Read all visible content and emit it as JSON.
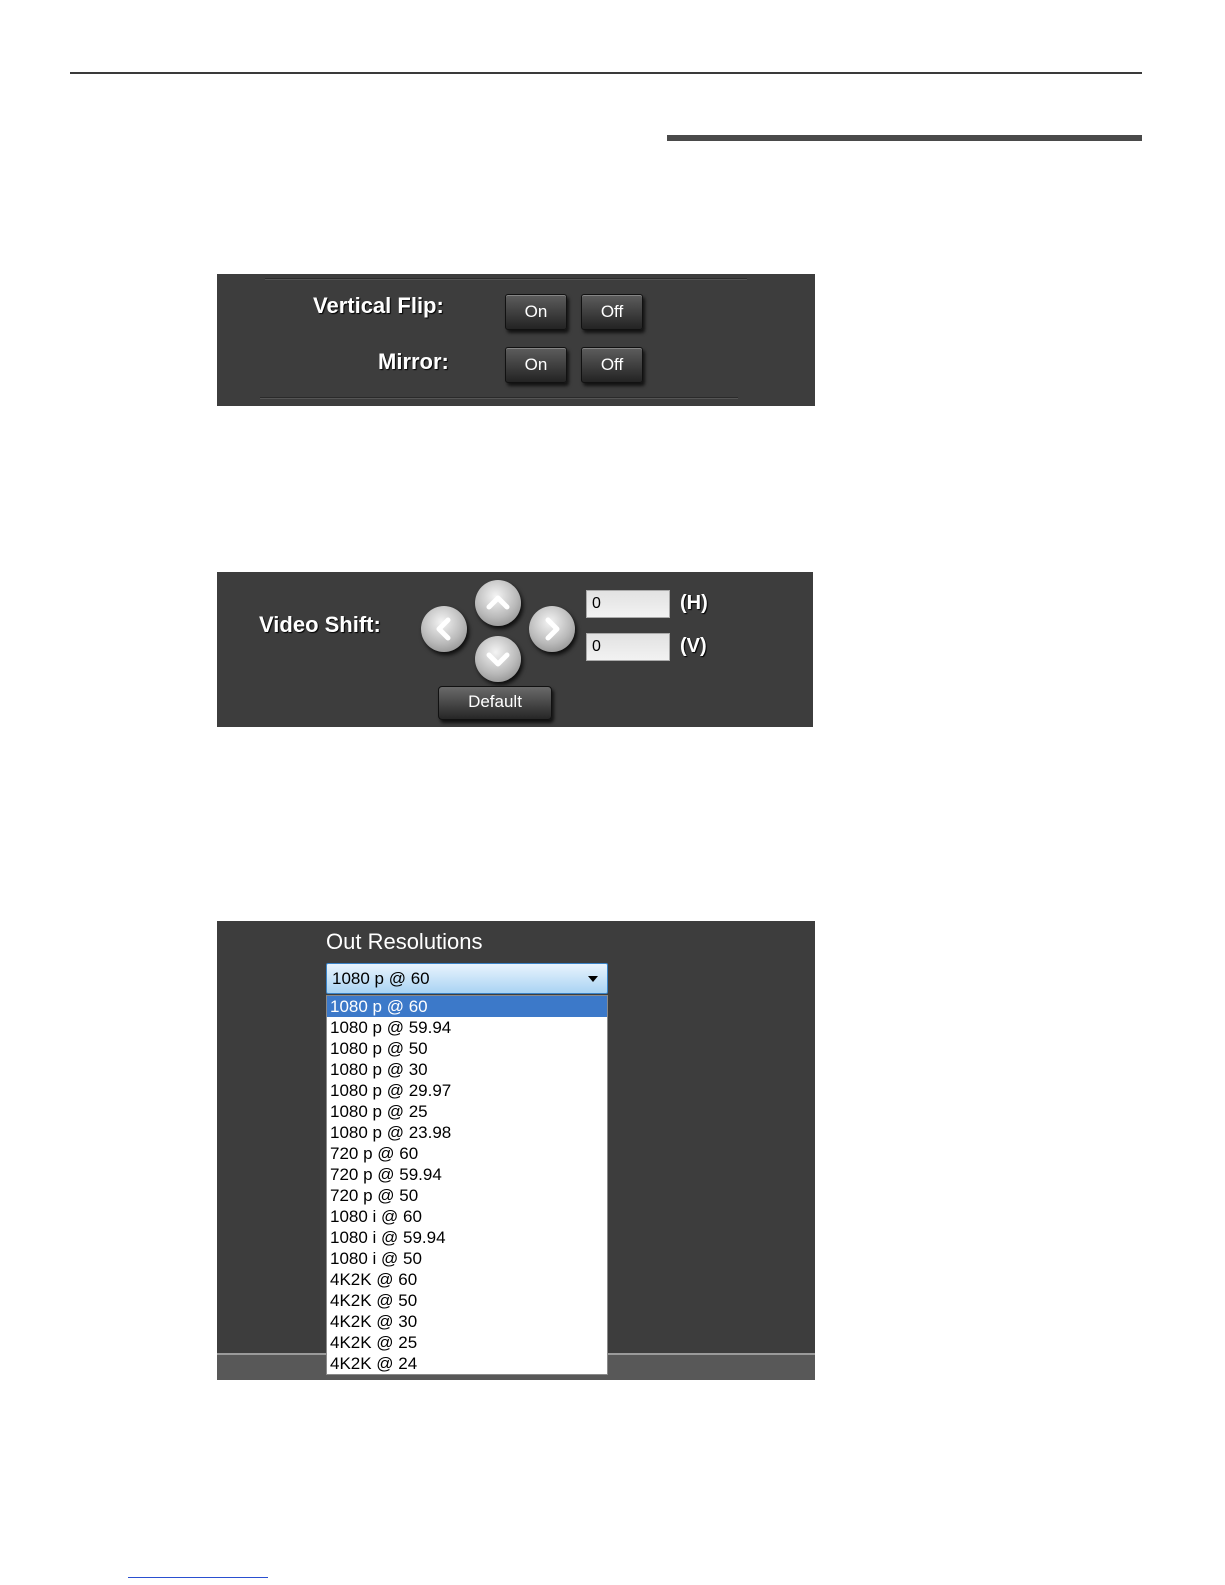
{
  "flip_panel": {
    "vertical_flip_label": "Vertical Flip:",
    "mirror_label": "Mirror:",
    "on_label": "On",
    "off_label": "Off"
  },
  "shift_panel": {
    "label": "Video Shift:",
    "h_value": "0",
    "v_value": "0",
    "h_unit": "(H)",
    "v_unit": "(V)",
    "default_label": "Default"
  },
  "resolution_panel": {
    "title": "Out Resolutions",
    "selected": "1080 p @ 60",
    "options": [
      "1080 p @ 60",
      "1080 p @ 59.94",
      "1080 p @ 50",
      "1080 p @ 30",
      "1080 p @ 29.97",
      "1080 p @ 25",
      "1080 p @ 23.98",
      "720 p @ 60",
      "720 p @ 59.94",
      "720 p @ 50",
      "1080 i @ 60",
      "1080 i @ 59.94",
      "1080 i @ 50",
      "4K2K @ 60",
      "4K2K @ 50",
      "4K2K @ 30",
      "4K2K @ 25",
      "4K2K @ 24"
    ]
  },
  "icons": {
    "up": "chevron-up-icon",
    "down": "chevron-down-icon",
    "left": "chevron-left-icon",
    "right": "chevron-right-icon"
  },
  "colors": {
    "panel_bg": "#3d3d3d",
    "dropdown_highlight": "#3c79c9"
  }
}
